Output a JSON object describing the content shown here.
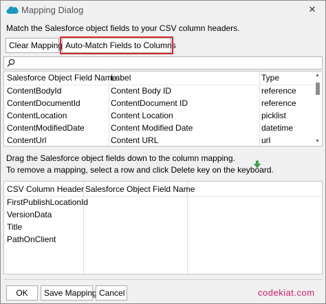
{
  "window": {
    "title": "Mapping Dialog"
  },
  "instruction": "Match the Salesforce object fields to your CSV column headers.",
  "toolbar": {
    "clear_label": "Clear Mapping",
    "automatch_label": "Auto-Match Fields to Columns"
  },
  "search": {
    "value": "",
    "placeholder": ""
  },
  "fields_table": {
    "columns": [
      "Salesforce Object Field Name",
      "Label",
      "Type"
    ],
    "rows": [
      [
        "ContentBodyId",
        "Content Body ID",
        "reference"
      ],
      [
        "ContentDocumentId",
        "ContentDocument ID",
        "reference"
      ],
      [
        "ContentLocation",
        "Content Location",
        "picklist"
      ],
      [
        "ContentModifiedDate",
        "Content Modified Date",
        "datetime"
      ],
      [
        "ContentUrl",
        "Content URL",
        "url"
      ]
    ]
  },
  "drag_hint": {
    "line1": "Drag the Salesforce object fields down to the column mapping.",
    "line2": "To remove a mapping, select a row and click Delete key on the keyboard."
  },
  "mapping_table": {
    "columns": [
      "CSV Column Header",
      "Salesforce Object Field Name"
    ],
    "rows": [
      [
        "FirstPublishLocationId",
        ""
      ],
      [
        "VersionData",
        ""
      ],
      [
        "Title",
        ""
      ],
      [
        "PathOnClient",
        ""
      ]
    ]
  },
  "footer": {
    "ok_label": "OK",
    "save_label": "Save Mapping",
    "cancel_label": "Cancel"
  },
  "watermark": "codekiat.com",
  "colors": {
    "highlight": "#d22a2a",
    "watermark": "#d01a6e",
    "salesforce_blue": "#1798c1",
    "drop_arrow": "#3aa34a"
  },
  "icons": {
    "app": "salesforce-cloud-icon",
    "search": "search-icon",
    "drop": "down-arrow-icon"
  }
}
